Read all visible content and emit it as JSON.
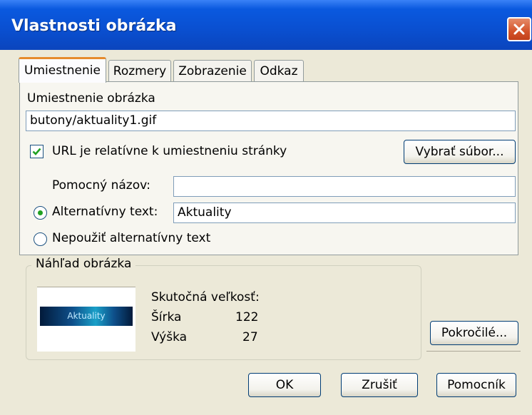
{
  "window": {
    "title": "Vlastnosti obrázka"
  },
  "tabs": [
    {
      "label": "Umiestnenie",
      "active": true
    },
    {
      "label": "Rozmery",
      "active": false
    },
    {
      "label": "Zobrazenie",
      "active": false
    },
    {
      "label": "Odkaz",
      "active": false
    }
  ],
  "location": {
    "section_label": "Umiestnenie obrázka",
    "url_value": "butony/aktuality1.gif",
    "relative_checkbox_label": "URL je relatívne k umiestneniu stránky",
    "relative_checked": true,
    "choose_file_button": "Vybrať súbor..."
  },
  "alt": {
    "tooltip_label": "Pomocný názov:",
    "tooltip_value": "",
    "alt_text_radio_label": "Alternatívny text:",
    "alt_text_value": "Aktuality",
    "no_alt_radio_label": "Nepoužiť alternatívny text",
    "selected": "alt_text"
  },
  "preview": {
    "group_label": "Náhľad obrázka",
    "image_text": "Aktuality",
    "actual_size_label": "Skutočná veľkosť:",
    "width_label": "Šírka",
    "width_value": "122",
    "height_label": "Výška",
    "height_value": "27"
  },
  "buttons": {
    "advanced": "Pokročilé...",
    "ok": "OK",
    "cancel": "Zrušiť",
    "help": "Pomocník"
  },
  "colors": {
    "titlebar": "#0a59df",
    "dialog_bg": "#ECE9D8",
    "active_tab_accent": "#e68b2c",
    "close_button": "#d4532a"
  }
}
